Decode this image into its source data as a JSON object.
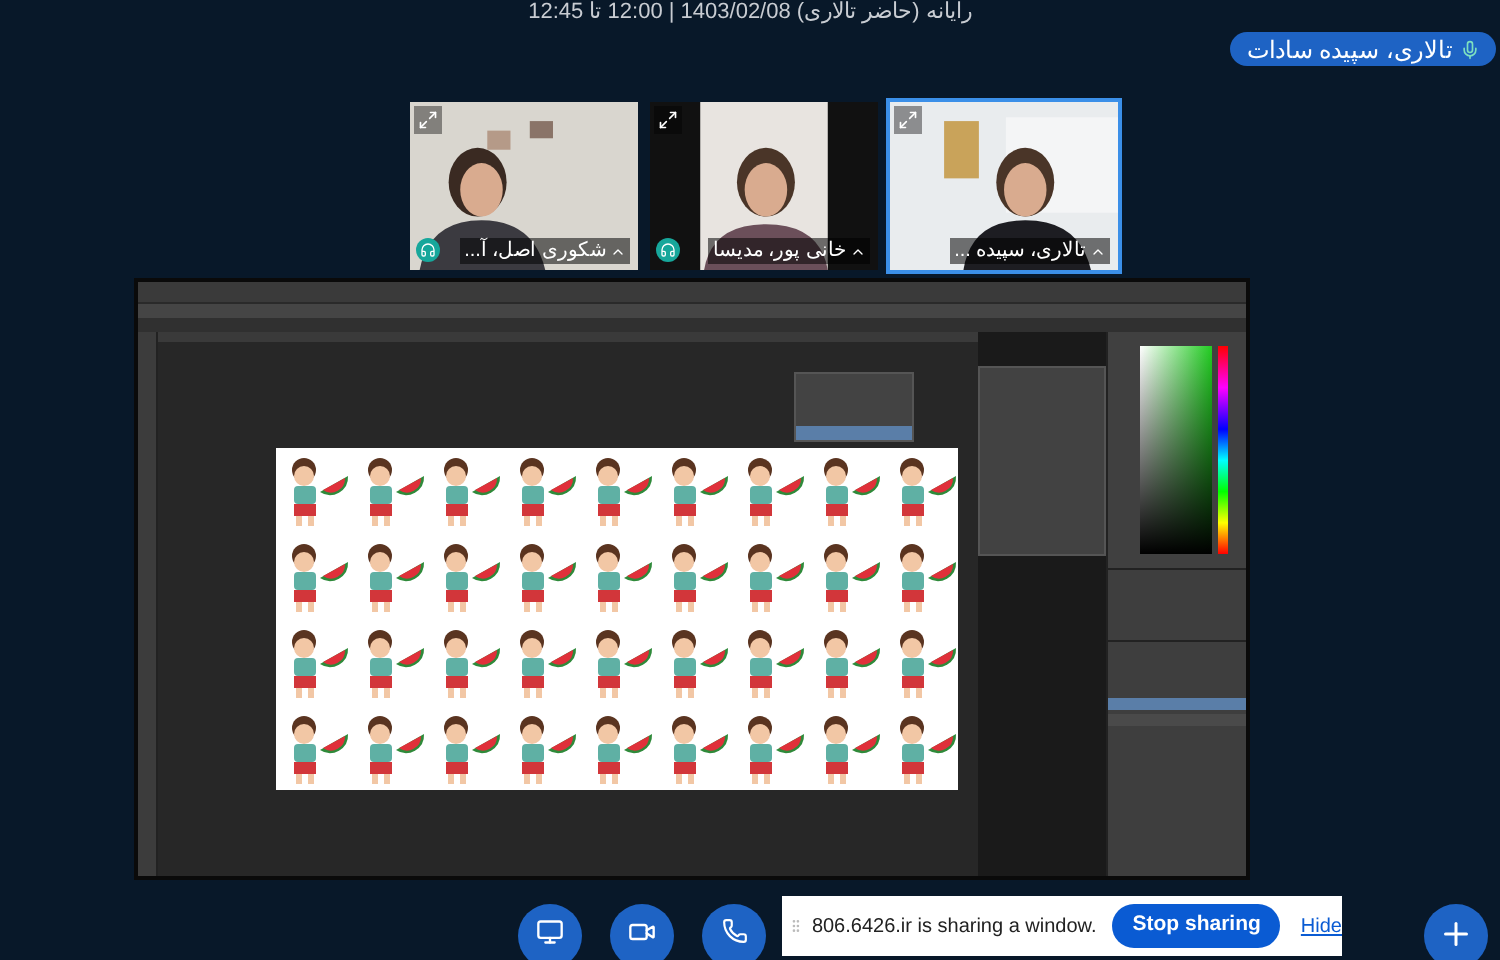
{
  "session_info": "رایانه (حاضر تالاری) 1403/02/08 | 12:00 تا 12:45",
  "presenter": {
    "name": "تالاری، سپیده سادات",
    "mic": true
  },
  "participants": [
    {
      "name": "تالاری، سپیده ...",
      "headset": false,
      "selected": true
    },
    {
      "name": "خانی پور، مدیسا",
      "headset": true,
      "selected": false
    },
    {
      "name": "شکوری اصل، آ...",
      "headset": true,
      "selected": false
    }
  ],
  "share_notice": {
    "text": "806.6426.ir is sharing a window.",
    "stop_button": "Stop sharing",
    "hide_link": "Hide"
  }
}
